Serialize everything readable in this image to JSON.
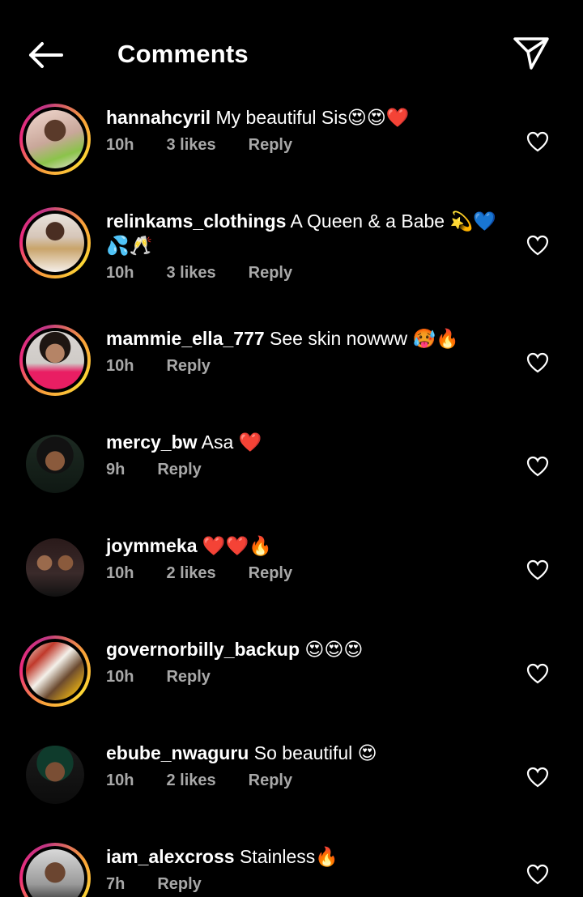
{
  "header": {
    "title": "Comments",
    "back_icon": "arrow-left-icon",
    "share_icon": "paper-plane-icon"
  },
  "comments": [
    {
      "username": "hannahcyril",
      "text": "My beautiful Sis😍😍❤️",
      "time": "10h",
      "likes": "3 likes",
      "reply": "Reply",
      "story_ring": true
    },
    {
      "username": "relinkams_clothings",
      "text": "A Queen & a Babe 💫💙💦🥂",
      "time": "10h",
      "likes": "3 likes",
      "reply": "Reply",
      "story_ring": true
    },
    {
      "username": "mammie_ella_777",
      "text": "See skin nowww 🥵🔥",
      "time": "10h",
      "likes": "",
      "reply": "Reply",
      "story_ring": true
    },
    {
      "username": "mercy_bw",
      "text": "Asa ❤️",
      "time": "9h",
      "likes": "",
      "reply": "Reply",
      "story_ring": false
    },
    {
      "username": "joymmeka",
      "text": "❤️❤️🔥",
      "time": "10h",
      "likes": "2 likes",
      "reply": "Reply",
      "story_ring": false
    },
    {
      "username": "governorbilly_backup",
      "text": "😍😍😍",
      "time": "10h",
      "likes": "",
      "reply": "Reply",
      "story_ring": true
    },
    {
      "username": "ebube_nwaguru",
      "text": "So beautiful 😍",
      "time": "10h",
      "likes": "2 likes",
      "reply": "Reply",
      "story_ring": false
    },
    {
      "username": "iam_alexcross",
      "text": "Stainless🔥",
      "time": "7h",
      "likes": "",
      "reply": "Reply",
      "story_ring": true
    }
  ]
}
